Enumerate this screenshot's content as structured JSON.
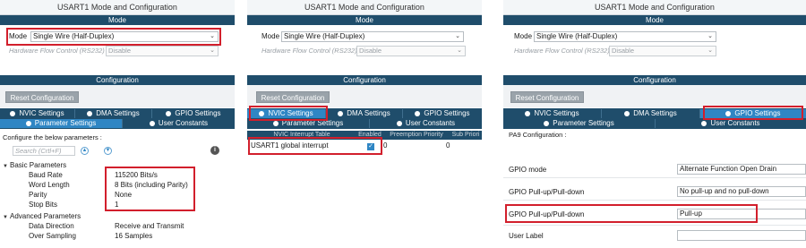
{
  "window_title": "USART1 Mode and Configuration",
  "mode_section": "Mode",
  "config_section": "Configuration",
  "mode": {
    "label": "Mode",
    "value": "Single Wire (Half-Duplex)"
  },
  "flow_control": {
    "label": "Hardware Flow Control (RS232)",
    "value": "Disable"
  },
  "reset_button": "Reset Configuration",
  "tabs": {
    "nvic": "NVIC Settings",
    "dma": "DMA Settings",
    "gpio": "GPIO Settings",
    "parameter": "Parameter Settings",
    "user_constants": "User Constants"
  },
  "panel1": {
    "configure_text": "Configure the below parameters :",
    "search_placeholder": "Search (Crtl+F)",
    "basic_group": "Basic Parameters",
    "advanced_group": "Advanced Parameters",
    "params": [
      {
        "name": "Baud Rate",
        "value": "115200 Bits/s"
      },
      {
        "name": "Word Length",
        "value": "8 Bits (including Parity)"
      },
      {
        "name": "Parity",
        "value": "None"
      },
      {
        "name": "Stop Bits",
        "value": "1"
      },
      {
        "name": "Data Direction",
        "value": "Receive and Transmit"
      },
      {
        "name": "Over Sampling",
        "value": "16 Samples"
      }
    ]
  },
  "panel2": {
    "columns": [
      "NVIC Interrupt Table",
      "Enabled",
      "Preemption Priority",
      "Sub Priori"
    ],
    "row": {
      "name": "USART1 global interrupt",
      "enabled_mark": "✓",
      "preemption": "0",
      "sub": "0"
    }
  },
  "panel3": {
    "pin_config": "PA9 Configuration :",
    "rows": [
      {
        "label": "GPIO mode",
        "value": "Alternate Function Open Drain"
      },
      {
        "label": "GPIO Pull-up/Pull-down",
        "value": "No pull-up and no pull-down"
      },
      {
        "label": "GPIO Pull-up/Pull-down",
        "value": "Pull-up"
      },
      {
        "label": "User Label",
        "value": ""
      }
    ]
  },
  "colors": {
    "header": "#1f4d6b",
    "active_tab": "#2f86c4",
    "highlight": "#d21f2c"
  }
}
